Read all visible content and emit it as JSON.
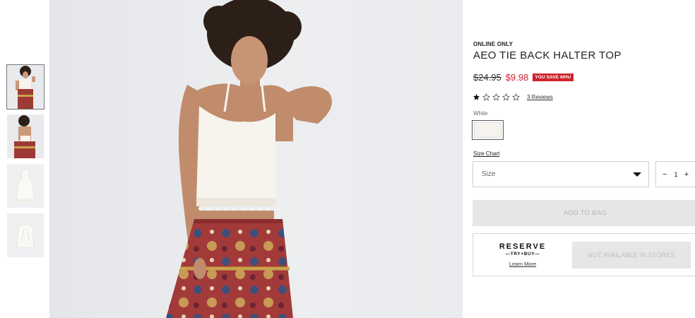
{
  "product": {
    "eyebrow": "ONLINE ONLY",
    "title": "AEO TIE BACK HALTER TOP",
    "price_old": "$24.95",
    "price_new": "$9.98",
    "save_badge": "YOU SAVE 60%!",
    "rating": 1,
    "rating_max": 5,
    "reviews_label": "3 Reviews",
    "color_label": "White",
    "size_chart_label": "Size Chart",
    "size_placeholder": "Size",
    "quantity": {
      "minus": "−",
      "value": "1",
      "plus": "+"
    },
    "add_to_bag_label": "ADD TO BAG",
    "reserve": {
      "word": "RESERVE",
      "tagline": "—TRY+BUY—",
      "learn_more": "Learn More",
      "status": "NOT AVAILABLE IN STORES"
    }
  },
  "icons": {
    "star_filled": "star-filled-icon",
    "star_empty": "star-empty-icon",
    "dropdown": "caret-down-icon"
  },
  "colors": {
    "sale_red": "#d0232c",
    "disabled_bg": "#e6e6e6",
    "disabled_text": "#b5b5b5"
  },
  "gallery": {
    "thumbnails": [
      "model-front",
      "model-back",
      "product-front",
      "product-back"
    ],
    "active_index": 0
  }
}
